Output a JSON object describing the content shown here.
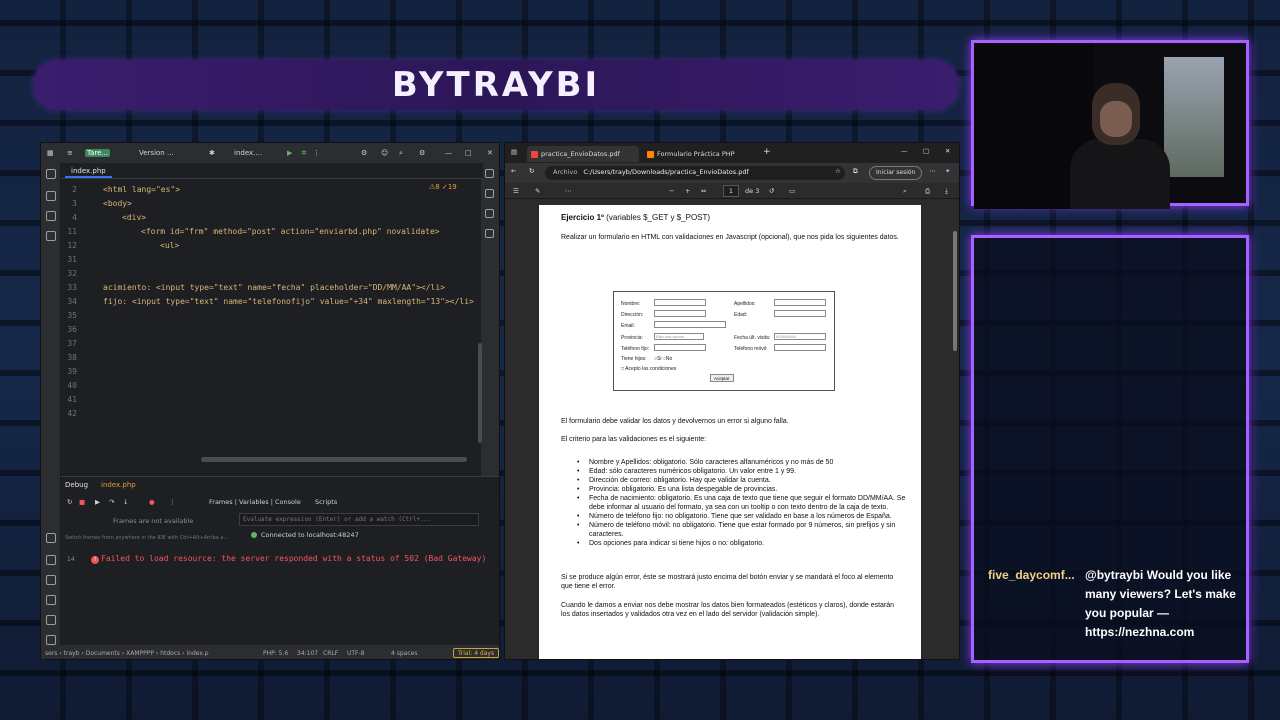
{
  "banner": {
    "title": "BYTRAYBI"
  },
  "ide": {
    "project": "Tare...",
    "vcs": "Version ...",
    "run_config": "index....",
    "tab": "index.php",
    "warnings": "⚠8 ✓19",
    "code_lines": [
      {
        "n": "2",
        "text": "<html lang=\"es\">",
        "indent": 0
      },
      {
        "n": "3",
        "text": "<body>",
        "indent": 0
      },
      {
        "n": "4",
        "text": "<div>",
        "indent": 1
      },
      {
        "n": "11",
        "text": "<form id=\"frm\" method=\"post\" action=\"enviarbd.php\" novalidate>",
        "indent": 2
      },
      {
        "n": "12",
        "text": "<ul>",
        "indent": 3
      },
      {
        "n": "31",
        "text": "",
        "indent": 0
      },
      {
        "n": "32",
        "text": "",
        "indent": 0
      },
      {
        "n": "33",
        "text": "acimiento: <input type=\"text\" name=\"fecha\" placeholder=\"DD/MM/AA\"></li>",
        "indent": 0
      },
      {
        "n": "34",
        "text": "fijo: <input type=\"text\" name=\"telefonofijo\" value=\"+34\" maxlength=\"13\"></li>",
        "indent": 0
      },
      {
        "n": "35",
        "text": "",
        "indent": 0
      },
      {
        "n": "36",
        "text": "",
        "indent": 0
      },
      {
        "n": "37",
        "text": "",
        "indent": 0
      },
      {
        "n": "38",
        "text": "",
        "indent": 0
      },
      {
        "n": "39",
        "text": "",
        "indent": 0
      },
      {
        "n": "40",
        "text": "",
        "indent": 0
      },
      {
        "n": "41",
        "text": "",
        "indent": 0
      },
      {
        "n": "42",
        "text": "",
        "indent": 0
      }
    ],
    "debug": {
      "tab_debug": "Debug",
      "tab_file": "index.php",
      "tabs": "Frames | Variables | Console",
      "scripts": "Scripts",
      "frames_empty": "Frames are not available",
      "eval_placeholder": "Evaluate expression (Enter) or add a watch (Ctrl+...",
      "connected": "Connected to localhost:48247",
      "hint": "Switch frames from anywhere in the IDE with Ctrl+Alt+Arriba a...",
      "error_count": "14",
      "error": "Failed to load resource: the server responded with a status of 502 (Bad Gateway)"
    },
    "status": {
      "path": "sers › trayb › Documents › XAMPPPP › htdocs › index.p",
      "php": "PHP: 5.6",
      "pos": "34:107",
      "eol": "CRLF",
      "enc": "UTF-8",
      "indent": "4 spaces",
      "trial": "Trial: 4 days"
    }
  },
  "browser": {
    "tab1": "practica_EnvioDatos.pdf",
    "tab2": "Formulario Práctica PHP",
    "url_prefix": "Archivo",
    "url": "C:/Users/trayb/Downloads/practica_EnvioDatos.pdf",
    "login": "Iniciar sesión",
    "page_current": "1",
    "page_total": "de 3",
    "pdf": {
      "title_bold": "Ejercicio 1º",
      "title_rest": " (variables $_GET y $_POST)",
      "intro": "Realizar un formulario en HTML con validaciones en Javascript (opcional), que nos pida los siguientes datos.",
      "form": {
        "nombre": "Nombre:",
        "apellidos": "Apellidos:",
        "direccion": "Dirección:",
        "edad": "Edad:",
        "email": "Email:",
        "provincia": "Provincia:",
        "provincia_sel": "Elija una opción",
        "fecha": "Fecha últ. visita:",
        "fecha_ph": "DD/MM/AA",
        "tfijo": "Teléfono fijo:",
        "tmovil": "Teléfono móvil:",
        "hijos": "Tiene hijos:",
        "si": "Si",
        "no": "No",
        "acepto": "Acepto las condiciones",
        "aceptar": "Aceptar"
      },
      "p1": "El formulario debe validar los datos y devolvernos un error si alguno falla.",
      "p2": "El criterio para las validaciones es el siguiente:",
      "bullets": [
        "Nombre y Apellidos: obligatorio. Sólo caracteres alfanuméricos y no más de 50",
        "Edad: sólo caracteres numéricos obligatorio. Un valor entre 1 y 99.",
        "Dirección de correo: obligatorio. Hay que validar la cuenta.",
        "Provincia: obligatorio. Es una lista despegable de provincias.",
        "Fecha de nacimiento: obligatorio. Es una caja de texto que tiene que seguir el formato DD/MM/AA. Se debe informar al usuario del formato, ya sea con un tooltip o con texto dentro de la caja de texto.",
        "Número de teléfono fijo: no obligatorio. Tiene que ser validado en base a los números de España.",
        "Número de teléfono móvil: no obligatorio. Tiene que estar formado por 9 números, sin prefijos y sin caracteres.",
        "Dos opciones para indicar si tiene hijos o no: obligatorio."
      ],
      "p3": "Si se produce algún error, éste se mostrará justo encima del botón enviar y se mandará el foco al elemento que tiene el error.",
      "p4": "Cuando le damos a enviar nos debe mostrar los datos bien formateados (estéticos y claros), donde estarán los datos insertados y validados otra vez en el lado del servidor (validación simple)."
    }
  },
  "chat": {
    "user": "five_daycomf...",
    "message": "@bytraybi Would you like many viewers? Let's make you popular — https://nezhna.com"
  },
  "colors": {
    "accent": "#a860ff",
    "banner": "#2c1657"
  }
}
